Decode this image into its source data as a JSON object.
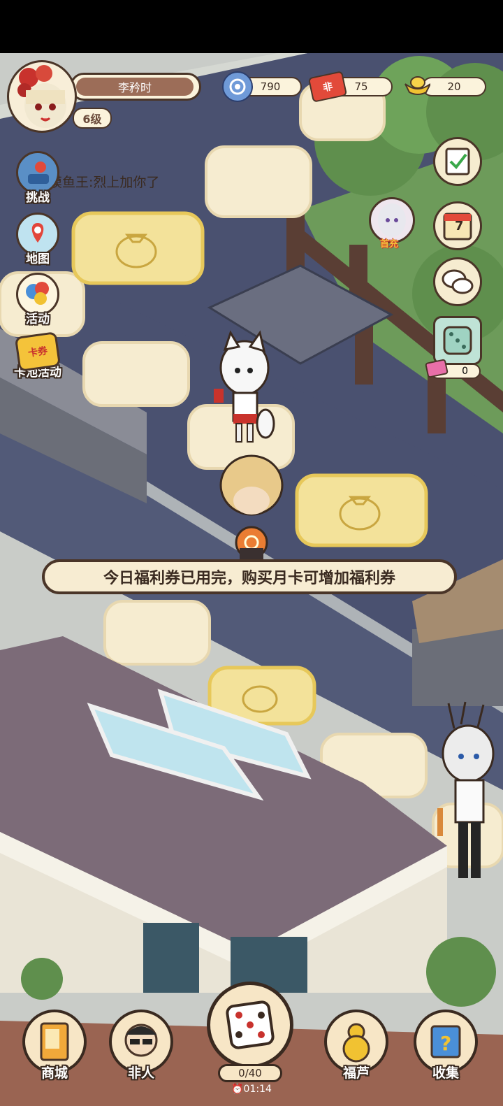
{
  "player": {
    "name": "李矜时",
    "level": "6级"
  },
  "resources": {
    "snail": "790",
    "ticket": "75",
    "ticket_icon_text": "非",
    "gold": "20"
  },
  "chat": {
    "message": "摸鱼王:烈上加你了"
  },
  "left_menu": [
    {
      "label": "挑战"
    },
    {
      "label": "地图"
    },
    {
      "label": "活动"
    },
    {
      "label": "卡池活动",
      "icon_text": "卡券"
    }
  ],
  "right_menu": {
    "first_recharge": "首充",
    "calendar_day": "7",
    "dice_ticket_count": "0"
  },
  "notice": {
    "text": "今日福利券已用完，购买月卡可增加福利券"
  },
  "bottom_nav": [
    {
      "label": "商城"
    },
    {
      "label": "非人"
    },
    {
      "label": "福芦"
    },
    {
      "label": "收集"
    }
  ],
  "dice": {
    "count": "0/40",
    "timer": "01:14"
  },
  "colors": {
    "road": "#4a5170",
    "sidewalk": "#d5d8d2",
    "tile": "#f6ecd0",
    "gold_tile": "#f3e29a",
    "grass": "#6d9b5a",
    "border": "#3a2a20"
  }
}
